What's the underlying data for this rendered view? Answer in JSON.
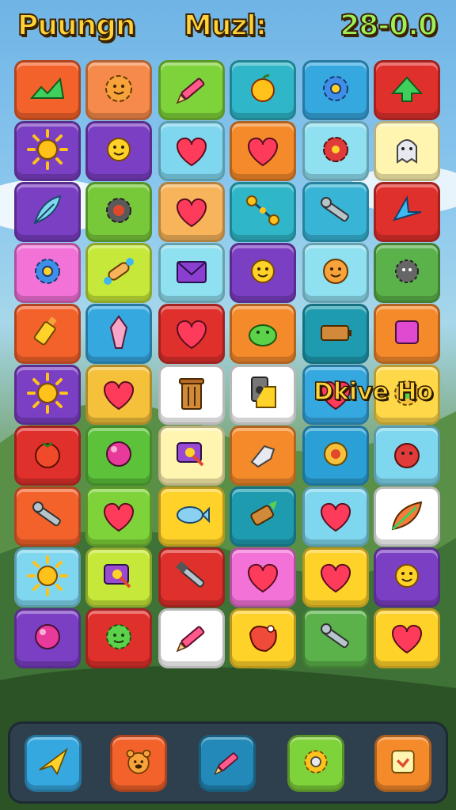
{
  "header": {
    "title": "Puungn",
    "mode": "Muzl:",
    "score": "28-0.0"
  },
  "overlay_text": "Dkive Ho",
  "board": {
    "rows": [
      [
        {
          "color": "#f4622b",
          "icon": "checkmark-icon"
        },
        {
          "color": "#f58a4a",
          "icon": "smiley-gear-icon"
        },
        {
          "color": "#7ed23a",
          "icon": "pencil-icon"
        },
        {
          "color": "#2fb7c9",
          "icon": "apple-icon"
        },
        {
          "color": "#36a8e0",
          "icon": "gear-icon"
        },
        {
          "color": "#e0302c",
          "icon": "arrow-check-icon"
        }
      ],
      [
        {
          "color": "#7b3fc4",
          "icon": "sun-icon"
        },
        {
          "color": "#7b3fc4",
          "icon": "sun-face-icon"
        },
        {
          "color": "#7fd7ef",
          "icon": "heart-icon"
        },
        {
          "color": "#f58a2b",
          "icon": "heart-icon"
        },
        {
          "color": "#8fe0f0",
          "icon": "flower-icon"
        },
        {
          "color": "#fff4b0",
          "icon": "ghost-icon"
        }
      ],
      [
        {
          "color": "#7b3fc4",
          "icon": "feather-icon"
        },
        {
          "color": "#78c93a",
          "icon": "cog-icon"
        },
        {
          "color": "#f7b45a",
          "icon": "heart-icon"
        },
        {
          "color": "#2fb7c9",
          "icon": "dumbbell-icon"
        },
        {
          "color": "#38b5d6",
          "icon": "wrench-icon"
        },
        {
          "color": "#e0302c",
          "icon": "arrow-icon"
        }
      ],
      [
        {
          "color": "#f272d8",
          "icon": "gear-icon"
        },
        {
          "color": "#c6e83a",
          "icon": "bone-icon"
        },
        {
          "color": "#8fe0f0",
          "icon": "envelope-icon"
        },
        {
          "color": "#7b3fc4",
          "icon": "sun-face-icon"
        },
        {
          "color": "#8fe0f0",
          "icon": "smiley-icon"
        },
        {
          "color": "#5bb24a",
          "icon": "spiky-ball-icon"
        }
      ],
      [
        {
          "color": "#f4622b",
          "icon": "glue-icon"
        },
        {
          "color": "#36a8e0",
          "icon": "crystal-icon"
        },
        {
          "color": "#e0302c",
          "icon": "heart-icon"
        },
        {
          "color": "#f58a2b",
          "icon": "slime-icon"
        },
        {
          "color": "#1f9bb0",
          "icon": "battery-icon"
        },
        {
          "color": "#f58a2b",
          "icon": "square-icon"
        }
      ],
      [
        {
          "color": "#7b3fc4",
          "icon": "sun-icon"
        },
        {
          "color": "#f5c13a",
          "icon": "heart-icon"
        },
        {
          "color": "#ffffff",
          "icon": "trash-icon"
        },
        {
          "color": "#ffffff",
          "icon": "speaker-icon"
        },
        {
          "color": "#36a8e0",
          "icon": "heart-icon"
        },
        {
          "color": "#ffd84a",
          "icon": "gem-icon"
        }
      ],
      [
        {
          "color": "#e0302c",
          "icon": "tomato-icon"
        },
        {
          "color": "#5bc23a",
          "icon": "ball-icon"
        },
        {
          "color": "#fff4b0",
          "icon": "magnifier-icon"
        },
        {
          "color": "#f58a2b",
          "icon": "glove-icon"
        },
        {
          "color": "#2ba0d6",
          "icon": "ring-icon"
        },
        {
          "color": "#7fd7ef",
          "icon": "berry-icon"
        }
      ],
      [
        {
          "color": "#f4622b",
          "icon": "wrench-icon"
        },
        {
          "color": "#7ed23a",
          "icon": "heart-icon"
        },
        {
          "color": "#ffd22a",
          "icon": "fish-icon"
        },
        {
          "color": "#1f9bb0",
          "icon": "candy-icon"
        },
        {
          "color": "#7fd7ef",
          "icon": "heart-icon"
        },
        {
          "color": "#ffffff",
          "icon": "leaf-icon"
        }
      ],
      [
        {
          "color": "#7fd7ef",
          "icon": "sun-icon"
        },
        {
          "color": "#c6e83a",
          "icon": "magnifier-icon"
        },
        {
          "color": "#e0302c",
          "icon": "screwdriver-icon"
        },
        {
          "color": "#f272d8",
          "icon": "heart-icon"
        },
        {
          "color": "#ffd22a",
          "icon": "heart-icon"
        },
        {
          "color": "#7b3fc4",
          "icon": "sun-face-icon"
        }
      ],
      [
        {
          "color": "#7b3fc4",
          "icon": "ball-icon"
        },
        {
          "color": "#e0302c",
          "icon": "germ-icon"
        },
        {
          "color": "#ffffff",
          "icon": "pencil-icon"
        },
        {
          "color": "#ffd22a",
          "icon": "tag-icon"
        },
        {
          "color": "#5bb24a",
          "icon": "wrench-icon"
        },
        {
          "color": "#ffd22a",
          "icon": "heart-icon"
        }
      ]
    ]
  },
  "dock": [
    {
      "color": "#36a8e0",
      "icon": "paper-plane-icon"
    },
    {
      "color": "#f4622b",
      "icon": "bear-icon"
    },
    {
      "color": "#2389b8",
      "icon": "pencil-icon"
    },
    {
      "color": "#7ed23a",
      "icon": "sun-gear-icon"
    },
    {
      "color": "#f58a2b",
      "icon": "badge-icon"
    }
  ]
}
